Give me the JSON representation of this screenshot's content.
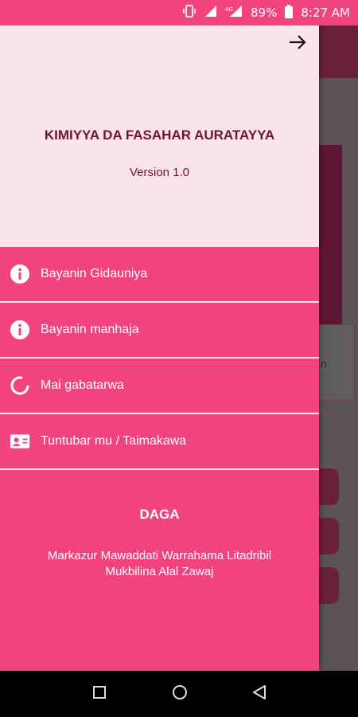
{
  "status_bar": {
    "battery": "89%",
    "time": "8:27 AM",
    "network": "4G"
  },
  "drawer": {
    "title": "KIMIYYA DA FASAHAR AURATAYYA",
    "version": "Version 1.0",
    "menu": [
      {
        "label": "Bayanin Gidauniya",
        "icon": "info-icon"
      },
      {
        "label": "Bayanin manhaja",
        "icon": "info-icon"
      },
      {
        "label": "Mai gabatarwa",
        "icon": "loading-circle-icon"
      },
      {
        "label": "Tuntubar mu / Taimakawa",
        "icon": "contact-card-icon"
      }
    ],
    "footer_title": "DAGA",
    "footer_text": "Markazur Mawaddati Warrahama Litadribil Mukbilina Alal Zawaj"
  },
  "background": {
    "partial_text": "n"
  },
  "colors": {
    "accent": "#f2447c",
    "header_bg": "#fbe3ea",
    "title_text": "#6c1533"
  }
}
